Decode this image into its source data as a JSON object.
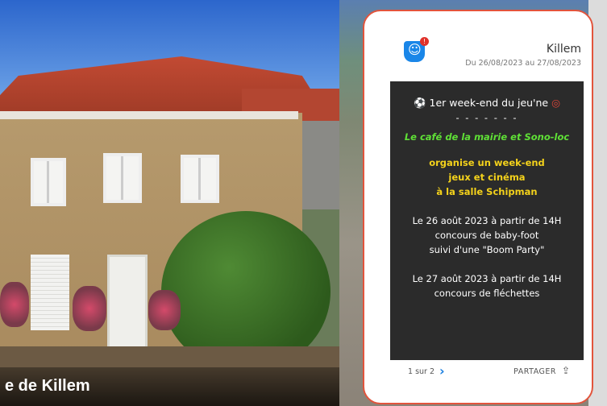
{
  "background": {
    "caption": "e de Killem"
  },
  "notification": {
    "app_icon": "smiley-chat-icon",
    "badge": "!",
    "town": "Killem",
    "dates": "Du 26/08/2023 au 27/08/2023",
    "title_prefix_icon": "globe-icon",
    "title": "1er week-end du jeu'ne",
    "title_suffix_icon": "target-icon",
    "dashes": "- - - - - - -",
    "green_text": "Le café de la mairie et Sono-loc",
    "yellow_lines": [
      "organise un week-end",
      "jeux et cinéma",
      "à la salle Schipman"
    ],
    "event1_lines": [
      "Le 26 août 2023 à partir de 14H",
      "concours de baby-foot",
      "suivi d'une \"Boom Party\""
    ],
    "event2_lines": [
      "Le 27 août 2023 à partir de 14H",
      "concours de fléchettes"
    ],
    "pager": "1 sur 2",
    "share_label": "PARTAGER",
    "colors": {
      "frame": "#e2543c",
      "post_bg": "#2b2b2b",
      "green": "#5fe036",
      "yellow": "#f4d21b",
      "accent": "#1a7fe0"
    }
  }
}
